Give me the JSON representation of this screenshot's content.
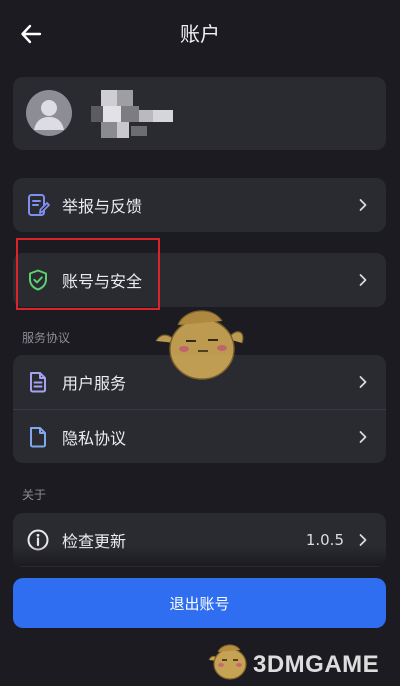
{
  "header": {
    "title": "账户",
    "back_icon": "back-arrow-icon"
  },
  "profile": {
    "avatar_icon": "default-user-avatar-icon",
    "name_redacted": true
  },
  "menu_top": [
    {
      "label": "举报与反馈",
      "icon": "report-feedback-icon",
      "icon_color": "#7f8ff0"
    }
  ],
  "menu_security": [
    {
      "label": "账号与安全",
      "icon": "shield-check-icon",
      "icon_color": "#5ccf6f"
    }
  ],
  "service": {
    "section_label": "服务协议",
    "items": [
      {
        "label": "用户服务",
        "icon": "document-lines-icon",
        "icon_color": "#a8a1f0"
      },
      {
        "label": "隐私协议",
        "icon": "document-icon",
        "icon_color": "#7fa8ee"
      }
    ]
  },
  "about": {
    "section_label": "关于",
    "items": [
      {
        "label": "检查更新",
        "value": "1.0.5",
        "icon": "info-circle-icon",
        "icon_color": "#e8e8ec"
      }
    ]
  },
  "logout": {
    "label": "退出账号",
    "color": "#2f6ef0"
  },
  "watermark": {
    "text": "3DMGAME"
  },
  "colors": {
    "background": "#1b1b21",
    "card": "#2a2a31",
    "annotation": "#d9232e"
  }
}
